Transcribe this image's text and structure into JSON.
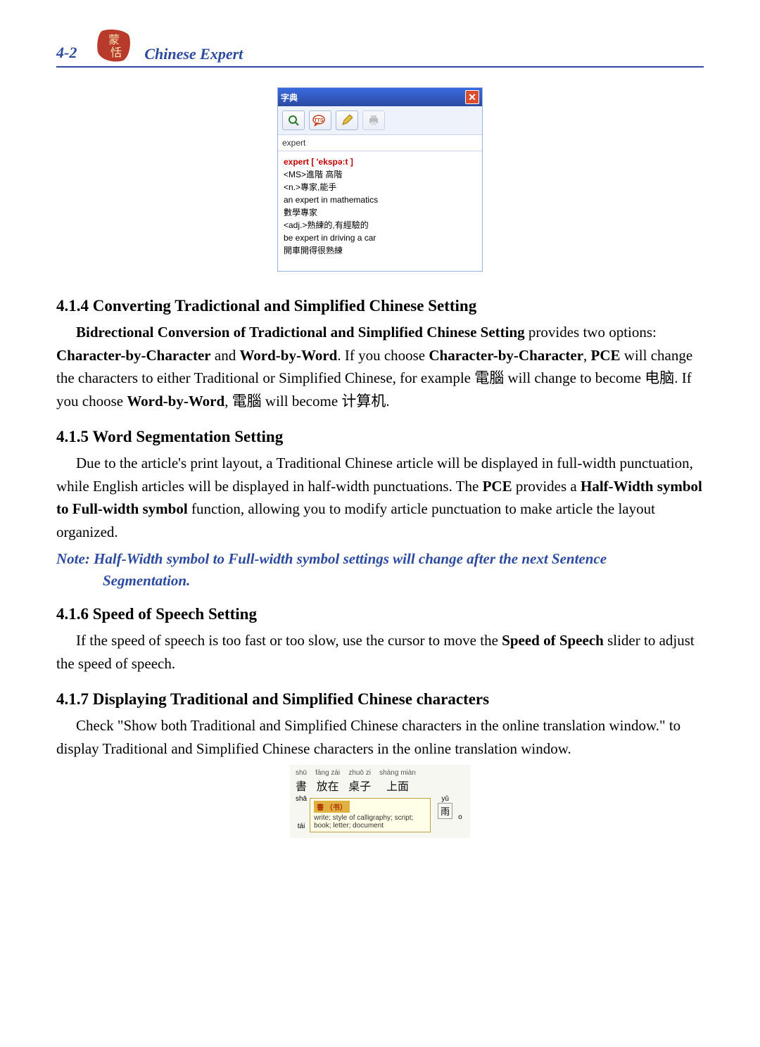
{
  "header": {
    "page_number": "4-2",
    "title": "Chinese Expert"
  },
  "dictionary": {
    "title": "字典",
    "input_value": "expert",
    "entry": {
      "headword": "expert [ 'ekspəːt ]",
      "lines": [
        "<MS>進階 高階",
        "<n.>專家,能手",
        "an expert in mathematics",
        "數學專家",
        "<adj.>熟練的,有經驗的",
        "be expert in driving a car",
        "開車開得很熟練"
      ]
    },
    "icons": [
      "search",
      "tts",
      "pencil",
      "print"
    ]
  },
  "sections": {
    "s414": {
      "heading": "4.1.4  Converting Tradictional and Simplified Chinese Setting",
      "para": [
        {
          "t": "Bidrectional Conversion of Tradictional and Simplified Chinese Setting",
          "b": true
        },
        {
          "t": " provides two options: "
        },
        {
          "t": "Character-by-Character",
          "b": true
        },
        {
          "t": " and "
        },
        {
          "t": "Word-by-Word",
          "b": true
        },
        {
          "t": ". If you choose "
        },
        {
          "t": "Character-by-Character",
          "b": true
        },
        {
          "t": ", "
        },
        {
          "t": "PCE",
          "b": true
        },
        {
          "t": " will change the characters to either Traditional or Simplified Chinese, for example 電腦 will change to become 电脑. If you choose "
        },
        {
          "t": "Word-by-Word",
          "b": true
        },
        {
          "t": ", 電腦 will become 计算机."
        }
      ]
    },
    "s415": {
      "heading": "4.1.5  Word Segmentation Setting",
      "para": [
        {
          "t": "Due to the article's print layout, a Traditional Chinese article will be displayed in full-width punctuation, while English articles will be displayed in half-width punctuations. The "
        },
        {
          "t": "PCE",
          "b": true
        },
        {
          "t": " provides a "
        },
        {
          "t": "Half-Width symbol to Full-width symbol",
          "b": true
        },
        {
          "t": " function, allowing you to modify article punctuation to make article the layout organized."
        }
      ],
      "note_l1": "Note: Half-Width symbol to Full-width symbol settings will change after the next Sentence",
      "note_l2": "Segmentation."
    },
    "s416": {
      "heading": "4.1.6  Speed of Speech Setting",
      "para": [
        {
          "t": "If the speed of speech is too fast or too slow, use the cursor to move the "
        },
        {
          "t": "Speed of Speech",
          "b": true
        },
        {
          "t": " slider to adjust the speed of speech."
        }
      ]
    },
    "s417": {
      "heading": "4.1.7  Displaying Traditional and Simplified Chinese characters",
      "para": [
        {
          "t": "Check \"Show both Traditional and Simplified Chinese characters in the online translation window.\" to display Traditional and Simplified Chinese characters in the online translation window."
        }
      ]
    }
  },
  "translation": {
    "row": [
      {
        "py": "shū",
        "ch": "書"
      },
      {
        "py": "fàng zài",
        "ch": "放在"
      },
      {
        "py": "zhuō zi",
        "ch": "桌子"
      },
      {
        "py": "shàng miàn",
        "ch": "上面"
      }
    ],
    "left_py": "shā",
    "left_py2": "tái",
    "tooltip_hdr": "書 （书）",
    "tooltip_body": "write; style of calligraphy; script; book; letter; document",
    "right_py": "yǔ",
    "right_ch": "雨",
    "right_tail": "o"
  }
}
